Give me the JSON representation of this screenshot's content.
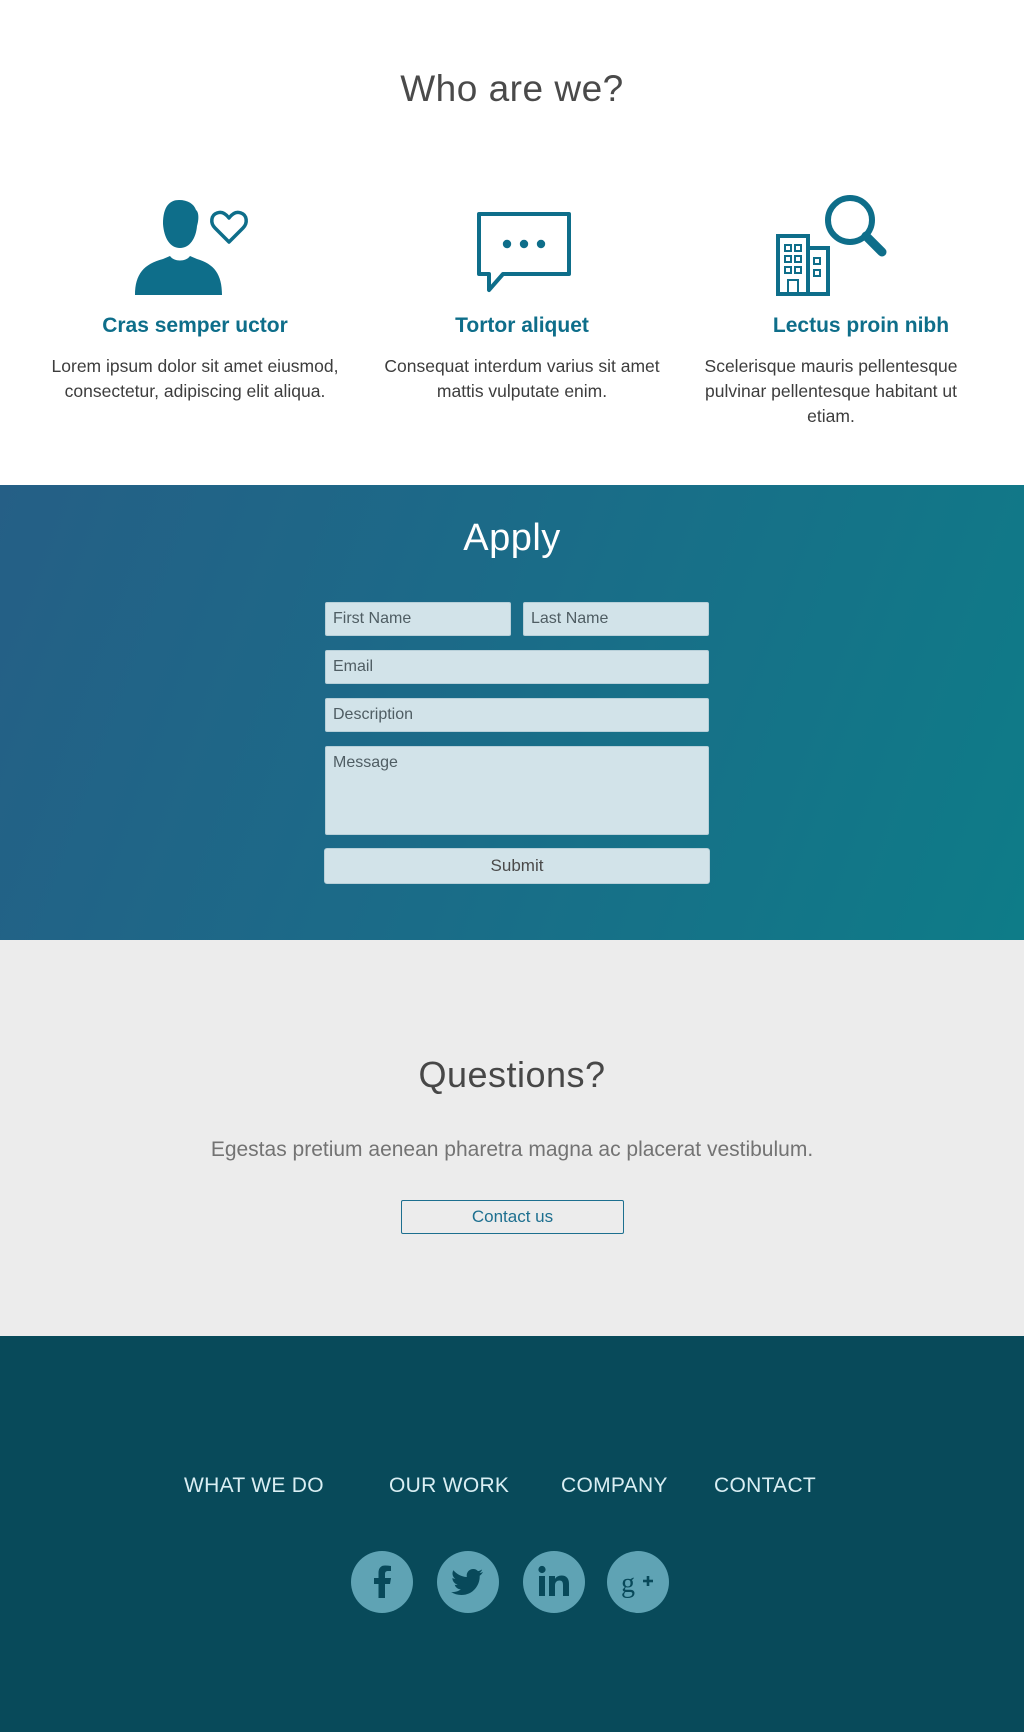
{
  "about": {
    "title": "Who are we?",
    "features": [
      {
        "icon": "user-heart-icon",
        "title": "Cras semper uctor",
        "text": "Lorem ipsum dolor sit amet eiusmod, consectetur, adipiscing elit aliqua."
      },
      {
        "icon": "chat-bubble-icon",
        "title": "Tortor aliquet",
        "text": "Consequat interdum varius sit amet mattis vulputate enim."
      },
      {
        "icon": "building-search-icon",
        "title": "Lectus proin nibh",
        "text": "Scelerisque mauris pellentesque pulvinar pellentesque habitant ut etiam."
      }
    ],
    "accent_color": "#0e6e8a"
  },
  "apply": {
    "title": "Apply",
    "first_name_placeholder": "First Name",
    "last_name_placeholder": "Last Name",
    "email_placeholder": "Email",
    "description_placeholder": "Description",
    "message_placeholder": "Message",
    "submit_label": "Submit"
  },
  "questions": {
    "title": "Questions?",
    "text": "Egestas pretium aenean pharetra magna ac placerat vestibulum.",
    "contact_label": "Contact us"
  },
  "footer": {
    "nav": [
      "WHAT WE DO",
      "OUR WORK",
      "COMPANY",
      "CONTACT"
    ],
    "social": [
      "facebook-icon",
      "twitter-icon",
      "linkedin-icon",
      "google-plus-icon"
    ],
    "background_color": "#084a5a"
  }
}
